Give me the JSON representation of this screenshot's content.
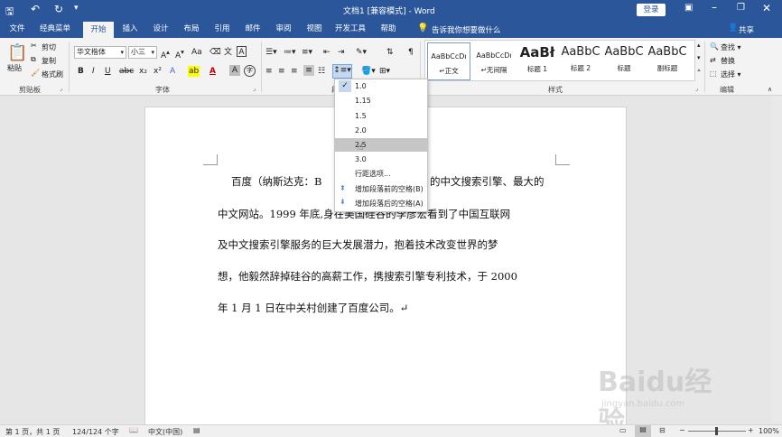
{
  "title": {
    "doc": "文档1 [兼容模式] - Word",
    "login": "登录"
  },
  "quick_access": {
    "save": "save-icon",
    "undo": "undo-icon",
    "redo": "redo-icon"
  },
  "tabs": [
    "文件",
    "经典菜单",
    "开始",
    "插入",
    "设计",
    "布局",
    "引用",
    "邮件",
    "审阅",
    "视图",
    "开发工具",
    "帮助"
  ],
  "active_tab": "开始",
  "tell_me": "告诉我你想要做什么",
  "share": "共享",
  "clipboard": {
    "paste": "粘贴",
    "cut": "剪切",
    "copy": "复制",
    "painter": "格式刷",
    "group": "剪贴板"
  },
  "font": {
    "name": "华文楷体",
    "size": "小三",
    "group": "字体",
    "b": "B",
    "i": "I",
    "u": "U",
    "a": "A"
  },
  "paragraph": {
    "group": "段"
  },
  "styles": {
    "group": "样式",
    "items": [
      {
        "preview": "AaBbCcDı",
        "name": "正文"
      },
      {
        "preview": "AaBbCcDı",
        "name": "无间隔"
      },
      {
        "preview": "AaBł",
        "name": "标题 1"
      },
      {
        "preview": "AaBbC",
        "name": "标题 2"
      },
      {
        "preview": "AaBbC",
        "name": "标题"
      },
      {
        "preview": "AaBbC",
        "name": "副标题"
      }
    ]
  },
  "editing": {
    "find": "查找",
    "replace": "替换",
    "select": "选择",
    "group": "编辑"
  },
  "spacing_menu": {
    "items": [
      "1.0",
      "1.15",
      "1.5",
      "2.0",
      "2.5",
      "3.0"
    ],
    "checked": "1.0",
    "hovered": "2.5",
    "options": "行距选项...",
    "add_before": "增加段落前的空格(B)",
    "add_after": "增加段落后的空格(A)"
  },
  "document": {
    "lines": [
      "百度（纳斯达克：B",
      "的中文搜索引擎、最大的",
      "中文网站。1999 年底,身在美国硅谷的李彦宏看到了中国互联网",
      "及中文搜索引擎服务的巨大发展潜力，抱着技术改变世界的梦",
      "想，他毅然辞掉硅谷的高薪工作，携搜索引擎专利技术，于 2000",
      "年 1 月 1 日在中关村创建了百度公司。↵"
    ]
  },
  "status": {
    "page": "第 1 页，共 1 页",
    "words": "124/124 个字",
    "lang": "中文(中国)",
    "zoom": "100%"
  },
  "watermark": {
    "brand": "Baidu经验",
    "url": "jingyan.baidu.com"
  }
}
